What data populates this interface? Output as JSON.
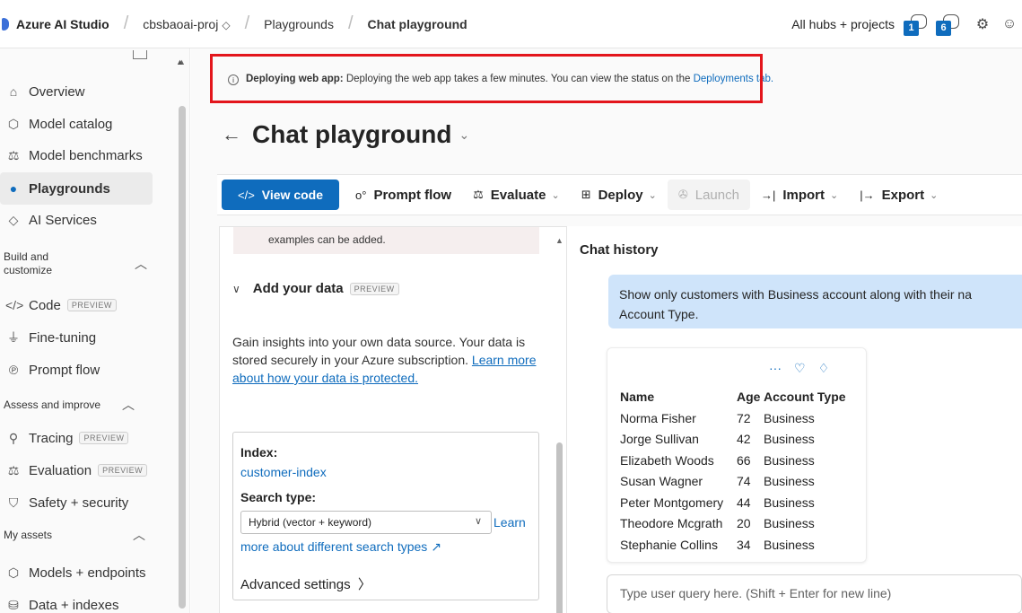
{
  "topbar": {
    "brand": "Azure AI Studio",
    "project": "cbsbaoai-proj",
    "breadcrumb_1": "Playgrounds",
    "breadcrumb_2": "Chat playground",
    "hubs_link": "All hubs + projects",
    "notif_count_1": "1",
    "notif_count_2": "6"
  },
  "sidebar": {
    "items": [
      {
        "label": "Overview",
        "icon": "home-icon"
      },
      {
        "label": "Model catalog",
        "icon": "cube-icon"
      },
      {
        "label": "Model benchmarks",
        "icon": "benchmark-icon"
      },
      {
        "label": "Playgrounds",
        "icon": "playground-icon"
      },
      {
        "label": "AI Services",
        "icon": "services-icon"
      }
    ],
    "section_build": "Build and customize",
    "build_items": [
      {
        "label": "Code",
        "badge": "PREVIEW"
      },
      {
        "label": "Fine-tuning"
      },
      {
        "label": "Prompt flow"
      }
    ],
    "section_assess": "Assess and improve",
    "assess_items": [
      {
        "label": "Tracing",
        "badge": "PREVIEW"
      },
      {
        "label": "Evaluation",
        "badge": "PREVIEW"
      },
      {
        "label": "Safety + security"
      }
    ],
    "section_assets": "My assets",
    "asset_items": [
      {
        "label": "Models + endpoints"
      },
      {
        "label": "Data + indexes"
      }
    ]
  },
  "banner": {
    "bold": "Deploying web app:",
    "text": " Deploying the web app takes a few minutes. You can view the status on the ",
    "link": "Deployments tab."
  },
  "page": {
    "title": "Chat playground"
  },
  "toolbar": {
    "view_code": "View code",
    "prompt_flow": "Prompt flow",
    "evaluate": "Evaluate",
    "deploy": "Deploy",
    "launch": "Launch",
    "import": "Import",
    "export": "Export"
  },
  "setup": {
    "examples_text": "examples can be added.",
    "add_data_title": "Add your data",
    "add_data_badge": "PREVIEW",
    "desc": "Gain insights into your own data source. Your data is stored securely in your Azure subscription. ",
    "desc_link": "Learn more about how your data is protected.",
    "index_label": "Index:",
    "index_value": "customer-index",
    "search_type_label": "Search type:",
    "search_type_value": "Hybrid (vector + keyword)",
    "learn_a": "Learn",
    "learn_b": "more about different search types",
    "advanced": "Advanced settings"
  },
  "chat": {
    "title": "Chat history",
    "user_msg_line1": "Show only customers with Business account  along with their na",
    "user_msg_line2": "Account Type.",
    "table": {
      "headers": [
        "Name",
        "Age",
        "Account Type"
      ],
      "rows": [
        [
          "Norma Fisher",
          "72",
          "Business"
        ],
        [
          "Jorge Sullivan",
          "42",
          "Business"
        ],
        [
          "Elizabeth Woods",
          "66",
          "Business"
        ],
        [
          "Susan Wagner",
          "74",
          "Business"
        ],
        [
          "Peter Montgomery",
          "44",
          "Business"
        ],
        [
          "Theodore Mcgrath",
          "20",
          "Business"
        ],
        [
          "Stephanie Collins",
          "34",
          "Business"
        ]
      ]
    },
    "input_placeholder": "Type user query here. (Shift + Enter for new line)"
  }
}
